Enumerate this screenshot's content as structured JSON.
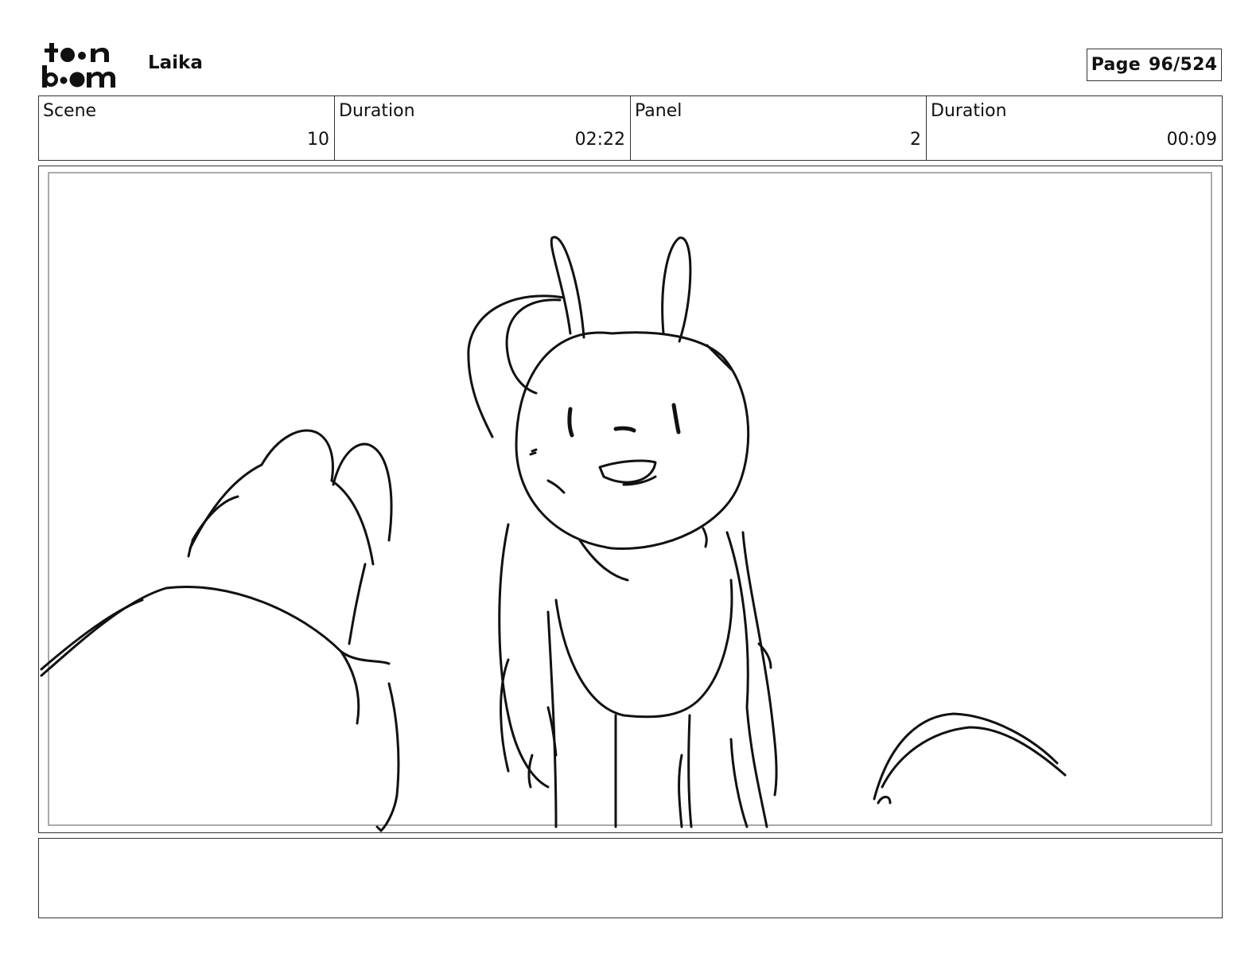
{
  "header": {
    "logo_text": "toonboom",
    "project_name": "Laika",
    "page_label": "Page",
    "page_number": "96/524"
  },
  "info": {
    "scene_label": "Scene",
    "scene_value": "10",
    "scene_duration_label": "Duration",
    "scene_duration_value": "02:22",
    "panel_label": "Panel",
    "panel_value": "2",
    "panel_duration_label": "Duration",
    "panel_duration_value": "00:09"
  },
  "panel": {
    "image_icon": "storyboard-sketch"
  },
  "notes": {
    "text": ""
  }
}
